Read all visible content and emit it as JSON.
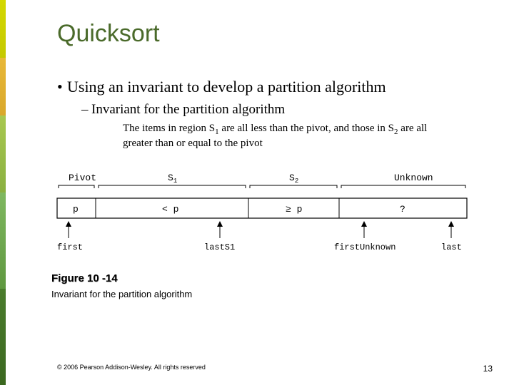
{
  "title": "Quicksort",
  "bullet1": "Using an invariant to develop a partition algorithm",
  "bullet2": "Invariant for the partition algorithm",
  "body_pre": "The items in region S",
  "body_sub1": "1",
  "body_mid": " are all less than the pivot, and those in S",
  "body_sub2": "2",
  "body_post": " are all greater than or equal to the pivot",
  "figure": {
    "label_pivot": "Pivot",
    "label_s1": "S",
    "label_s1_sub": "1",
    "label_s2": "S",
    "label_s2_sub": "2",
    "label_unknown": "Unknown",
    "box_p": "p",
    "box_lt": "< p",
    "box_ge": "≥ p",
    "box_q": "?",
    "ptr_first": "first",
    "ptr_lastS1": "lastS1",
    "ptr_firstUnknown": "firstUnknown",
    "ptr_last": "last",
    "number": "Figure 10 -14",
    "caption": "Invariant for the partition algorithm"
  },
  "copyright": "© 2006 Pearson Addison-Wesley. All rights reserved",
  "page": "13"
}
